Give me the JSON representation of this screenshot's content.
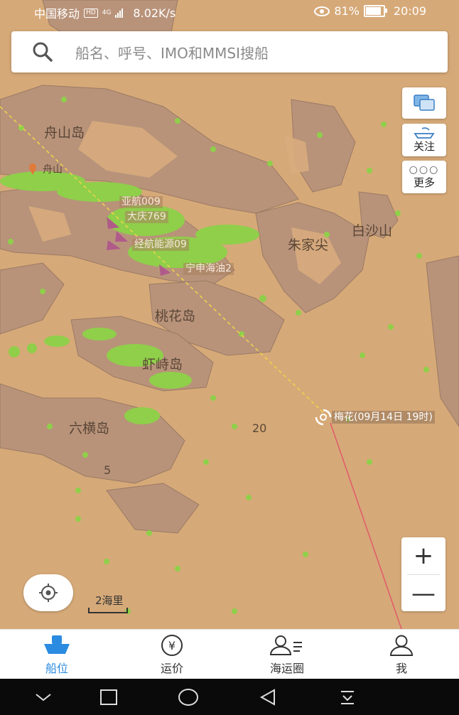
{
  "status_bar": {
    "carrier": "中国移动",
    "hd_badge": "HD",
    "network": "4G",
    "speed": "8.02K/s",
    "battery": "81%",
    "time": "20:09"
  },
  "search": {
    "placeholder": "船名、呼号、IMO和MMSI搜船"
  },
  "side_buttons": {
    "follow": "关注",
    "more": "更多"
  },
  "map": {
    "places": {
      "zhoushan_island": "舟山岛",
      "zhoushan_city": "舟山",
      "zhujiajian": "朱家尖",
      "baisha": "白沙山",
      "taohua": "桃花岛",
      "xiazhi": "虾峙岛",
      "liuheng": "六横岛",
      "depth_20": "20",
      "depth_5": "5"
    },
    "ships": [
      "亚航009",
      "大庆769",
      "经航能源09",
      "宁申海油2"
    ],
    "typhoon": {
      "label": "梅花(09月14日 19时)"
    },
    "scale_label": "2海里"
  },
  "tabs": [
    {
      "label": "船位",
      "active": true
    },
    {
      "label": "运价",
      "active": false
    },
    {
      "label": "海运圈",
      "active": false
    },
    {
      "label": "我",
      "active": false
    }
  ],
  "colors": {
    "accent": "#2b8be0",
    "sea": "#d6a978",
    "land": "#b8937a",
    "ship_dots": "#8fcf4a",
    "track": "#e05a6a"
  }
}
